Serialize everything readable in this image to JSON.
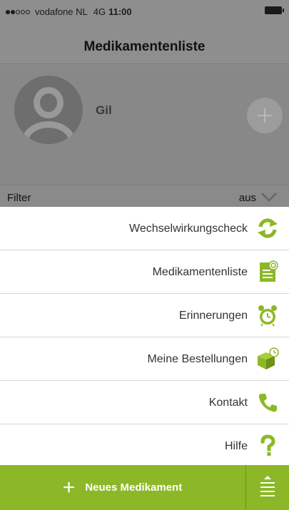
{
  "status_bar": {
    "carrier": "vodafone NL",
    "network": "4G",
    "time": "11:00",
    "signal_dots_filled": 2,
    "signal_dots_total": 5
  },
  "nav": {
    "title": "Medikamentenliste"
  },
  "profile": {
    "name": "Gil"
  },
  "filter": {
    "label": "Filter",
    "value": "aus"
  },
  "menu": {
    "items": [
      {
        "label": "Wechselwirkungscheck",
        "icon": "interaction-check-icon"
      },
      {
        "label": "Medikamentenliste",
        "icon": "medication-list-icon"
      },
      {
        "label": "Erinnerungen",
        "icon": "alarm-clock-icon"
      },
      {
        "label": "Meine Bestellungen",
        "icon": "orders-box-icon"
      },
      {
        "label": "Kontakt",
        "icon": "phone-icon"
      },
      {
        "label": "Hilfe",
        "icon": "help-icon"
      }
    ]
  },
  "bottom_bar": {
    "new_label": "Neues Medikament"
  },
  "colors": {
    "accent": "#8cb827",
    "accent_dark": "#6e9117",
    "dim_overlay": "#8e8e8e"
  }
}
